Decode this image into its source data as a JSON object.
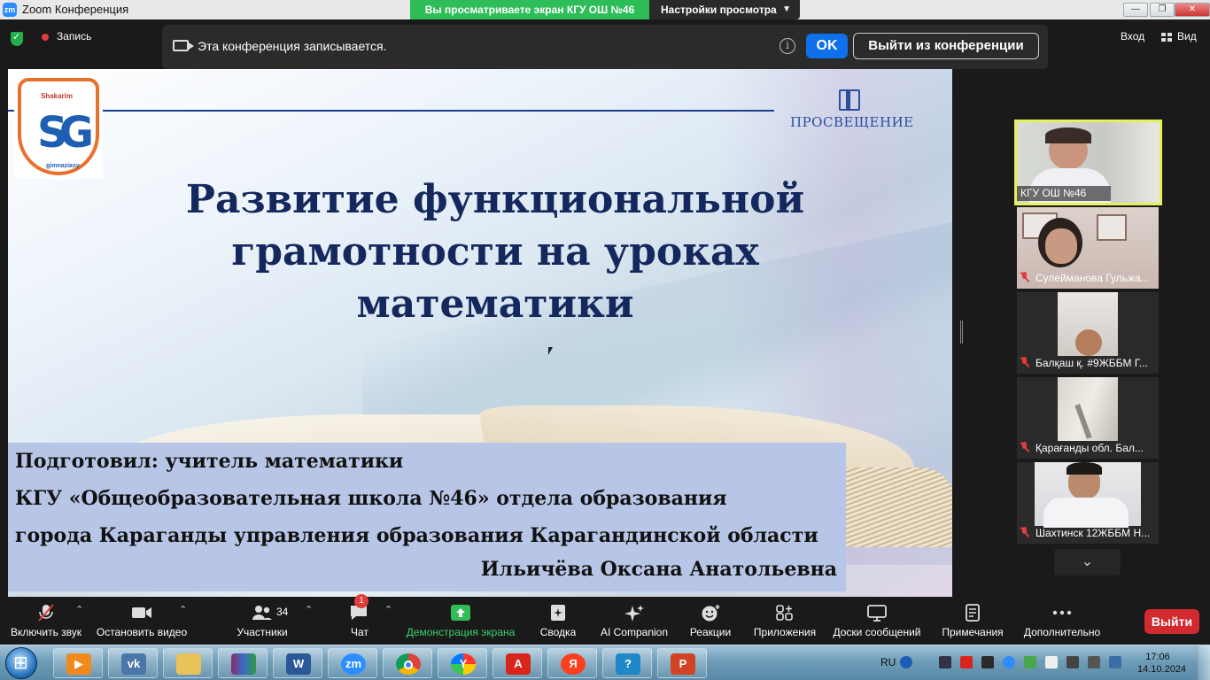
{
  "window": {
    "title": "Zoom Конференция",
    "share_banner": "Вы просматриваете экран КГУ ОШ №46",
    "view_settings": "Настройки просмотра"
  },
  "topbar": {
    "record_label": "Запись",
    "notice_text": "Эта конференция записывается.",
    "ok_label": "OK",
    "leave_label": "Выйти из конференции",
    "enter_label": "Вход",
    "view_label": "Вид"
  },
  "slide": {
    "logo_top": "Shakarim",
    "logo_letters": "SG",
    "logo_bottom": "gimnaziasy",
    "publisher": "ПРОСВЕЩЕНИЕ",
    "title_lines": [
      "Развитие функциональной",
      "грамотности на уроках",
      "математики"
    ],
    "author_lines": [
      "Подготовил: учитель математики",
      "КГУ «Общеобразовательная школа №46» отдела образования",
      "города Караганды управления образования Карагандинской области"
    ],
    "author_name": "Ильичёва Оксана Анатольевна"
  },
  "participants": [
    {
      "name": "КГУ ОШ №46",
      "muted": false,
      "active": true
    },
    {
      "name": "Сулейманова Гульжа...",
      "muted": true,
      "active": false
    },
    {
      "name": "Балқаш қ. #9ЖББМ Г...",
      "muted": true,
      "active": false
    },
    {
      "name": "Қарағанды обл. Бал...",
      "muted": true,
      "active": false
    },
    {
      "name": "Шахтинск 12ЖББМ Н...",
      "muted": true,
      "active": false
    }
  ],
  "toolbar": {
    "unmute": "Включить звук",
    "stop_video": "Остановить видео",
    "participants": "Участники",
    "participants_count": "34",
    "chat": "Чат",
    "chat_badge": "1",
    "share_screen": "Демонстрация экрана",
    "summary": "Сводка",
    "ai_companion": "AI Companion",
    "reactions": "Реакции",
    "apps": "Приложения",
    "whiteboards": "Доски сообщений",
    "notes": "Примечания",
    "more": "Дополнительно",
    "exit": "Выйти"
  },
  "taskbar": {
    "apps": [
      "media-player",
      "vk",
      "file-explorer",
      "winrar",
      "word",
      "zoom",
      "chrome",
      "yandex-browser",
      "acrobat",
      "yandex",
      "app-blue",
      "powerpoint"
    ],
    "lang": "RU",
    "time": "17:06",
    "date": "14.10.2024"
  },
  "colors": {
    "accent_blue": "#0e71eb",
    "share_green": "#2ebd59",
    "exit_red": "#d12a2f",
    "title_navy": "#14285e"
  }
}
